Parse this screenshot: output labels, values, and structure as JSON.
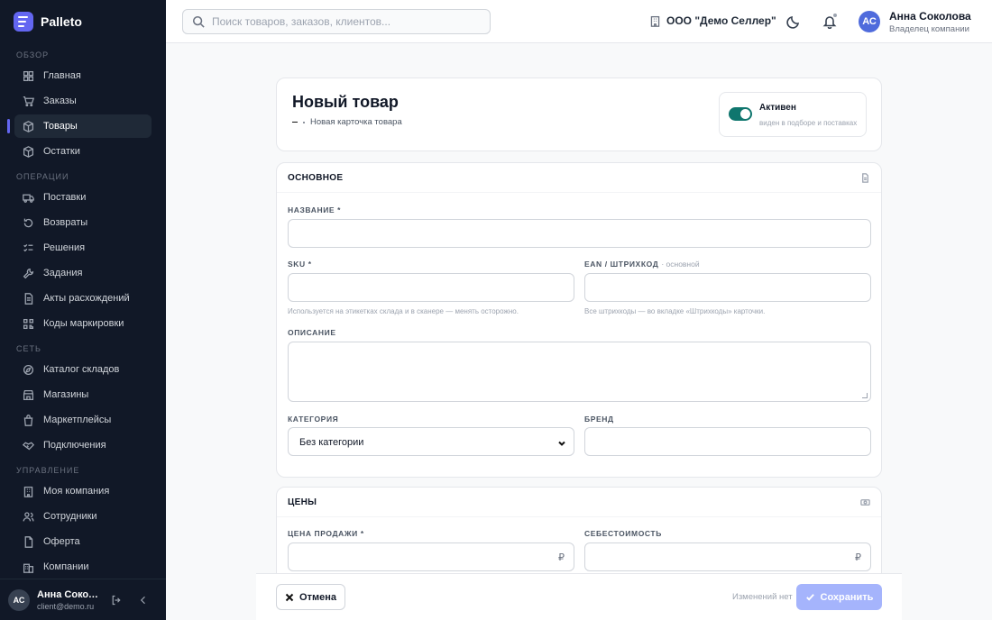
{
  "brand": {
    "name": "Palleto",
    "color": "#6366f1"
  },
  "sidebar": {
    "sections": [
      {
        "title": "ОБЗОР",
        "items": [
          {
            "label": "Главная",
            "icon": "dashboard-icon"
          },
          {
            "label": "Заказы",
            "icon": "cart-icon"
          },
          {
            "label": "Товары",
            "icon": "box-icon",
            "active": true
          },
          {
            "label": "Остатки",
            "icon": "cube-icon"
          }
        ]
      },
      {
        "title": "ОПЕРАЦИИ",
        "items": [
          {
            "label": "Поставки",
            "icon": "truck-icon"
          },
          {
            "label": "Возвраты",
            "icon": "return-icon"
          },
          {
            "label": "Решения",
            "icon": "checklist-icon"
          },
          {
            "label": "Задания",
            "icon": "wrench-icon"
          },
          {
            "label": "Акты расхождений",
            "icon": "document-icon"
          },
          {
            "label": "Коды маркировки",
            "icon": "qr-icon"
          }
        ]
      },
      {
        "title": "СЕТЬ",
        "items": [
          {
            "label": "Каталог складов",
            "icon": "compass-icon"
          },
          {
            "label": "Магазины",
            "icon": "store-icon"
          },
          {
            "label": "Маркетплейсы",
            "icon": "bag-icon"
          },
          {
            "label": "Подключения",
            "icon": "handshake-icon"
          }
        ]
      },
      {
        "title": "УПРАВЛЕНИЕ",
        "items": [
          {
            "label": "Моя компания",
            "icon": "building-icon"
          },
          {
            "label": "Сотрудники",
            "icon": "users-icon"
          },
          {
            "label": "Оферта",
            "icon": "file-icon"
          },
          {
            "label": "Компании",
            "icon": "buildings-icon"
          }
        ]
      }
    ],
    "footer_user": {
      "initials": "АС",
      "name": "Анна Соколова",
      "email": "client@demo.ru"
    }
  },
  "topbar": {
    "search_placeholder": "Поиск товаров, заказов, клиентов...",
    "company": "ООО \"Демо Селлер\"",
    "user": {
      "initials": "АС",
      "name": "Анна Соколова",
      "role": "Владелец компании"
    }
  },
  "header": {
    "title": "Новый товар",
    "breadcrumb_current": "Новая карточка товара",
    "status": {
      "label": "Активен",
      "sub": "виден в подборе и поставках",
      "on": true,
      "color": "#0f766e"
    }
  },
  "basic": {
    "title": "ОСНОВНОЕ",
    "name_label": "НАЗВАНИЕ *",
    "sku_label": "SKU *",
    "sku_hint": "Используется на этикетках склада и в сканере — менять осторожно.",
    "ean_label": "EAN / ШТРИХКОД",
    "ean_sub": "· основной",
    "ean_hint": "Все штрихкоды — во вкладке «Штрихкоды» карточки.",
    "desc_label": "ОПИСАНИЕ",
    "category_label": "КАТЕГОРИЯ",
    "category_value": "Без категории",
    "brand_label": "БРЕНД"
  },
  "prices": {
    "title": "ЦЕНЫ",
    "sale_label": "ЦЕНА ПРОДАЖИ *",
    "cost_label": "СЕБЕСТОИМОСТЬ",
    "currency": "₽"
  },
  "footer": {
    "cancel": "Отмена",
    "no_changes": "Изменений нет",
    "save": "Сохранить",
    "save_color": "#a5b4fc"
  }
}
